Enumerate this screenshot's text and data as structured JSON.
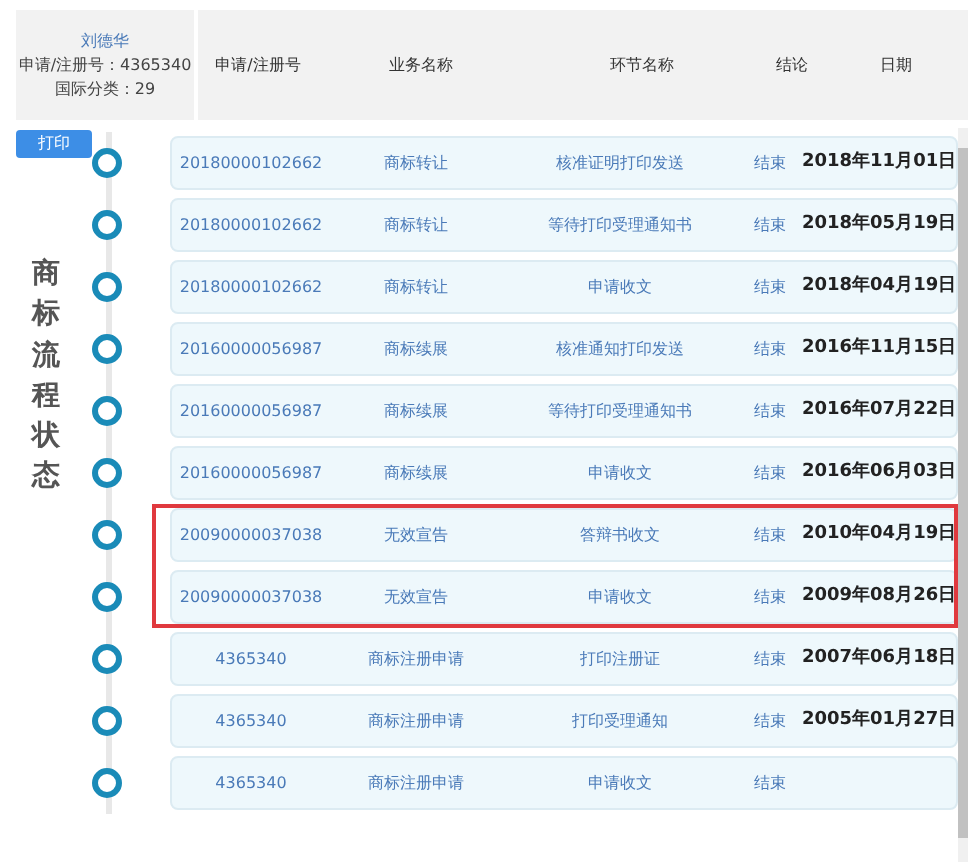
{
  "owner": {
    "name": "刘德华",
    "reg_no": "申请/注册号：4365340",
    "class": "国际分类：29"
  },
  "columns": [
    "申请/注册号",
    "业务名称",
    "环节名称",
    "结论",
    "日期"
  ],
  "print_button": "打印",
  "side_label": "商标流程状态",
  "rows": [
    {
      "number": "20180000102662",
      "business": "商标转让",
      "step": "核准证明打印发送",
      "result": "结束",
      "date": "2018年11月01日",
      "highlighted": false
    },
    {
      "number": "20180000102662",
      "business": "商标转让",
      "step": "等待打印受理通知书",
      "result": "结束",
      "date": "2018年05月19日",
      "highlighted": false
    },
    {
      "number": "20180000102662",
      "business": "商标转让",
      "step": "申请收文",
      "result": "结束",
      "date": "2018年04月19日",
      "highlighted": false
    },
    {
      "number": "20160000056987",
      "business": "商标续展",
      "step": "核准通知打印发送",
      "result": "结束",
      "date": "2016年11月15日",
      "highlighted": false
    },
    {
      "number": "20160000056987",
      "business": "商标续展",
      "step": "等待打印受理通知书",
      "result": "结束",
      "date": "2016年07月22日",
      "highlighted": false
    },
    {
      "number": "20160000056987",
      "business": "商标续展",
      "step": "申请收文",
      "result": "结束",
      "date": "2016年06月03日",
      "highlighted": false
    },
    {
      "number": "20090000037038",
      "business": "无效宣告",
      "step": "答辩书收文",
      "result": "结束",
      "date": "2010年04月19日",
      "highlighted": true
    },
    {
      "number": "20090000037038",
      "business": "无效宣告",
      "step": "申请收文",
      "result": "结束",
      "date": "2009年08月26日",
      "highlighted": true
    },
    {
      "number": "4365340",
      "business": "商标注册申请",
      "step": "打印注册证",
      "result": "结束",
      "date": "2007年06月18日",
      "highlighted": false
    },
    {
      "number": "4365340",
      "business": "商标注册申请",
      "step": "打印受理通知",
      "result": "结束",
      "date": "2005年01月27日",
      "highlighted": false
    },
    {
      "number": "4365340",
      "business": "商标注册申请",
      "step": "申请收文",
      "result": "结束",
      "date": "",
      "highlighted": false
    }
  ]
}
